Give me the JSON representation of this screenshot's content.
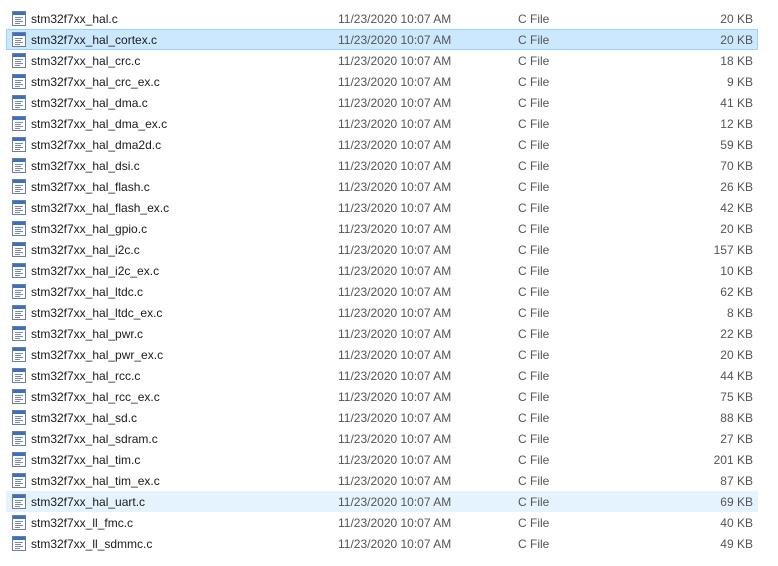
{
  "files": [
    {
      "name": "stm32f7xx_hal.c",
      "date": "11/23/2020 10:07 AM",
      "type": "C File",
      "size": "20 KB",
      "state": ""
    },
    {
      "name": "stm32f7xx_hal_cortex.c",
      "date": "11/23/2020 10:07 AM",
      "type": "C File",
      "size": "20 KB",
      "state": "selected"
    },
    {
      "name": "stm32f7xx_hal_crc.c",
      "date": "11/23/2020 10:07 AM",
      "type": "C File",
      "size": "18 KB",
      "state": ""
    },
    {
      "name": "stm32f7xx_hal_crc_ex.c",
      "date": "11/23/2020 10:07 AM",
      "type": "C File",
      "size": "9 KB",
      "state": ""
    },
    {
      "name": "stm32f7xx_hal_dma.c",
      "date": "11/23/2020 10:07 AM",
      "type": "C File",
      "size": "41 KB",
      "state": ""
    },
    {
      "name": "stm32f7xx_hal_dma_ex.c",
      "date": "11/23/2020 10:07 AM",
      "type": "C File",
      "size": "12 KB",
      "state": ""
    },
    {
      "name": "stm32f7xx_hal_dma2d.c",
      "date": "11/23/2020 10:07 AM",
      "type": "C File",
      "size": "59 KB",
      "state": ""
    },
    {
      "name": "stm32f7xx_hal_dsi.c",
      "date": "11/23/2020 10:07 AM",
      "type": "C File",
      "size": "70 KB",
      "state": ""
    },
    {
      "name": "stm32f7xx_hal_flash.c",
      "date": "11/23/2020 10:07 AM",
      "type": "C File",
      "size": "26 KB",
      "state": ""
    },
    {
      "name": "stm32f7xx_hal_flash_ex.c",
      "date": "11/23/2020 10:07 AM",
      "type": "C File",
      "size": "42 KB",
      "state": ""
    },
    {
      "name": "stm32f7xx_hal_gpio.c",
      "date": "11/23/2020 10:07 AM",
      "type": "C File",
      "size": "20 KB",
      "state": ""
    },
    {
      "name": "stm32f7xx_hal_i2c.c",
      "date": "11/23/2020 10:07 AM",
      "type": "C File",
      "size": "157 KB",
      "state": ""
    },
    {
      "name": "stm32f7xx_hal_i2c_ex.c",
      "date": "11/23/2020 10:07 AM",
      "type": "C File",
      "size": "10 KB",
      "state": ""
    },
    {
      "name": "stm32f7xx_hal_ltdc.c",
      "date": "11/23/2020 10:07 AM",
      "type": "C File",
      "size": "62 KB",
      "state": ""
    },
    {
      "name": "stm32f7xx_hal_ltdc_ex.c",
      "date": "11/23/2020 10:07 AM",
      "type": "C File",
      "size": "8 KB",
      "state": ""
    },
    {
      "name": "stm32f7xx_hal_pwr.c",
      "date": "11/23/2020 10:07 AM",
      "type": "C File",
      "size": "22 KB",
      "state": ""
    },
    {
      "name": "stm32f7xx_hal_pwr_ex.c",
      "date": "11/23/2020 10:07 AM",
      "type": "C File",
      "size": "20 KB",
      "state": ""
    },
    {
      "name": "stm32f7xx_hal_rcc.c",
      "date": "11/23/2020 10:07 AM",
      "type": "C File",
      "size": "44 KB",
      "state": ""
    },
    {
      "name": "stm32f7xx_hal_rcc_ex.c",
      "date": "11/23/2020 10:07 AM",
      "type": "C File",
      "size": "75 KB",
      "state": ""
    },
    {
      "name": "stm32f7xx_hal_sd.c",
      "date": "11/23/2020 10:07 AM",
      "type": "C File",
      "size": "88 KB",
      "state": ""
    },
    {
      "name": "stm32f7xx_hal_sdram.c",
      "date": "11/23/2020 10:07 AM",
      "type": "C File",
      "size": "27 KB",
      "state": ""
    },
    {
      "name": "stm32f7xx_hal_tim.c",
      "date": "11/23/2020 10:07 AM",
      "type": "C File",
      "size": "201 KB",
      "state": ""
    },
    {
      "name": "stm32f7xx_hal_tim_ex.c",
      "date": "11/23/2020 10:07 AM",
      "type": "C File",
      "size": "87 KB",
      "state": ""
    },
    {
      "name": "stm32f7xx_hal_uart.c",
      "date": "11/23/2020 10:07 AM",
      "type": "C File",
      "size": "69 KB",
      "state": "hover"
    },
    {
      "name": "stm32f7xx_ll_fmc.c",
      "date": "11/23/2020 10:07 AM",
      "type": "C File",
      "size": "40 KB",
      "state": ""
    },
    {
      "name": "stm32f7xx_ll_sdmmc.c",
      "date": "11/23/2020 10:07 AM",
      "type": "C File",
      "size": "49 KB",
      "state": ""
    }
  ],
  "icon": "c-source-file-icon",
  "colors": {
    "selected_bg": "#cce8ff",
    "selected_border": "#99d1ff",
    "hover_bg": "#e5f3ff"
  }
}
